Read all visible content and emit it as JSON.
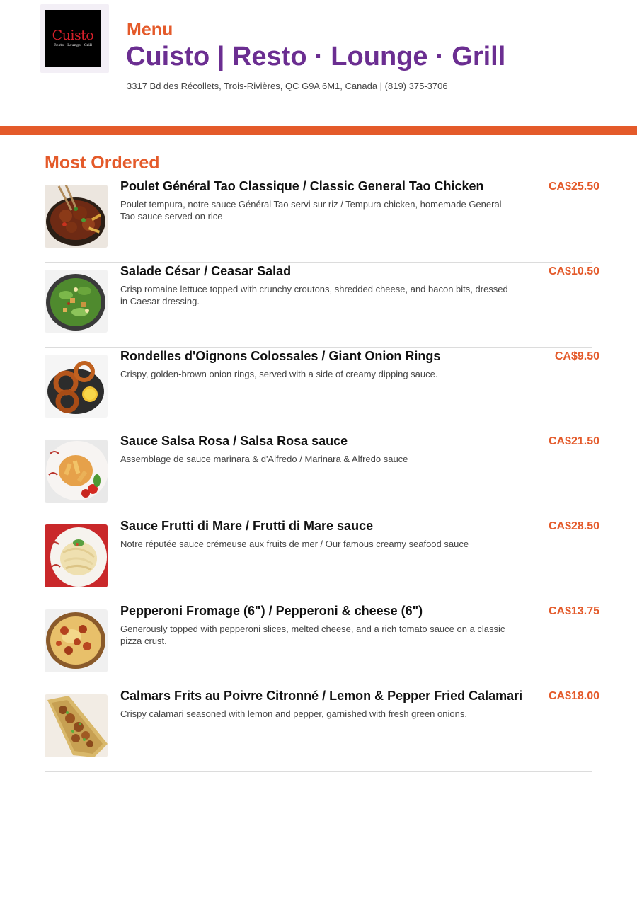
{
  "header": {
    "logo_name": "Cuisto",
    "logo_sub": "Resto · Lounge · Grill",
    "menu_label": "Menu",
    "restaurant_name": "Cuisto | Resto · Lounge · Grill",
    "address": "3317 Bd des Récollets, Trois-Rivières, QC G9A 6M1, Canada | (819) 375-3706"
  },
  "colors": {
    "accent": "#e45a2a",
    "brand": "#6b2e91"
  },
  "section": {
    "title": "Most Ordered",
    "items": [
      {
        "name": "Poulet Général Tao Classique / Classic General Tao Chicken",
        "description": "Poulet tempura, notre sauce Général Tao servi sur riz / Tempura chicken, homemade General Tao sauce served on rice",
        "price": "CA$25.50",
        "image": "general-tao-chicken-photo"
      },
      {
        "name": "Salade César / Ceasar Salad",
        "description": "Crisp romaine lettuce topped with crunchy croutons, shredded cheese, and bacon bits, dressed in Caesar dressing.",
        "price": "CA$10.50",
        "image": "caesar-salad-photo"
      },
      {
        "name": "Rondelles d'Oignons Colossales / Giant Onion Rings",
        "description": "Crispy, golden-brown onion rings, served with a side of creamy dipping sauce.",
        "price": "CA$9.50",
        "image": "onion-rings-photo"
      },
      {
        "name": "Sauce Salsa Rosa / Salsa Rosa sauce",
        "description": "Assemblage de sauce marinara & d'Alfredo / Marinara & Alfredo sauce",
        "price": "CA$21.50",
        "image": "salsa-rosa-pasta-photo"
      },
      {
        "name": "Sauce Frutti di Mare / Frutti di Mare sauce",
        "description": "Notre réputée sauce crémeuse aux fruits de mer / Our famous creamy seafood sauce",
        "price": "CA$28.50",
        "image": "frutti-di-mare-pasta-photo"
      },
      {
        "name": "Pepperoni Fromage (6\") / Pepperoni & cheese (6\")",
        "description": "Generously topped with pepperoni slices, melted cheese, and a rich tomato sauce on a classic pizza crust.",
        "price": "CA$13.75",
        "image": "pepperoni-pizza-photo"
      },
      {
        "name": "Calmars Frits au Poivre Citronné / Lemon & Pepper Fried Calamari",
        "description": "Crispy calamari seasoned with lemon and pepper, garnished with fresh green onions.",
        "price": "CA$18.00",
        "image": "fried-calamari-photo"
      }
    ]
  }
}
